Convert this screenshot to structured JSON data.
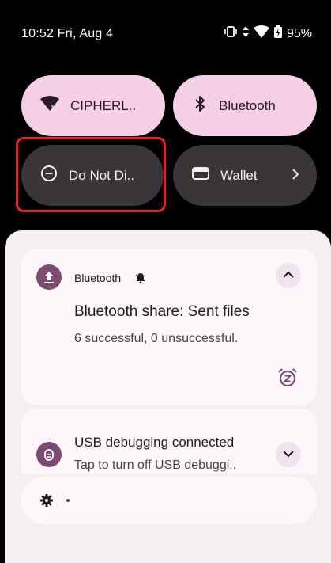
{
  "status_bar": {
    "time": "10:52 Fri, Aug 4",
    "battery": "95%"
  },
  "quick_settings": {
    "tiles": [
      {
        "label": "CIPHERL..",
        "state": "on",
        "icon": "wifi-icon"
      },
      {
        "label": "Bluetooth",
        "state": "on",
        "icon": "bluetooth-icon"
      },
      {
        "label": "Do Not Di..",
        "state": "off",
        "icon": "do-not-disturb-icon"
      },
      {
        "label": "Wallet",
        "state": "off",
        "icon": "wallet-icon"
      }
    ]
  },
  "notifications": [
    {
      "app": "Bluetooth",
      "title": "Bluetooth share: Sent files",
      "text": "6 successful, 0 unsuccessful."
    },
    {
      "title": "USB debugging connected",
      "text": "Tap to turn off USB debuggi.."
    }
  ],
  "colors": {
    "tile_on": "#f4cfe6",
    "tile_off": "#3a3538",
    "highlight": "#e8202a",
    "accent": "#7d4b71"
  }
}
